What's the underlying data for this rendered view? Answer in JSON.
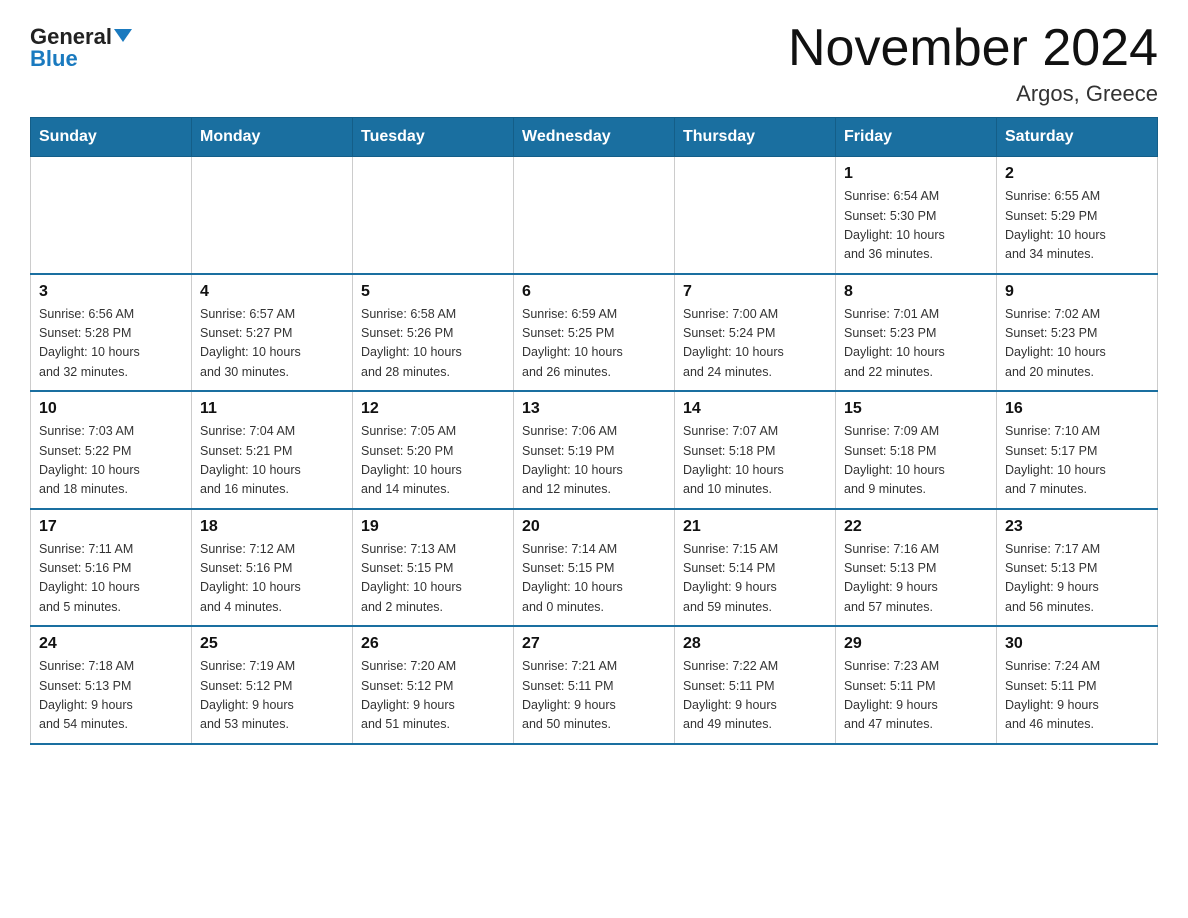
{
  "header": {
    "logo_general": "General",
    "logo_blue": "Blue",
    "title": "November 2024",
    "subtitle": "Argos, Greece"
  },
  "days_of_week": [
    "Sunday",
    "Monday",
    "Tuesday",
    "Wednesday",
    "Thursday",
    "Friday",
    "Saturday"
  ],
  "weeks": [
    [
      {
        "num": "",
        "info": ""
      },
      {
        "num": "",
        "info": ""
      },
      {
        "num": "",
        "info": ""
      },
      {
        "num": "",
        "info": ""
      },
      {
        "num": "",
        "info": ""
      },
      {
        "num": "1",
        "info": "Sunrise: 6:54 AM\nSunset: 5:30 PM\nDaylight: 10 hours\nand 36 minutes."
      },
      {
        "num": "2",
        "info": "Sunrise: 6:55 AM\nSunset: 5:29 PM\nDaylight: 10 hours\nand 34 minutes."
      }
    ],
    [
      {
        "num": "3",
        "info": "Sunrise: 6:56 AM\nSunset: 5:28 PM\nDaylight: 10 hours\nand 32 minutes."
      },
      {
        "num": "4",
        "info": "Sunrise: 6:57 AM\nSunset: 5:27 PM\nDaylight: 10 hours\nand 30 minutes."
      },
      {
        "num": "5",
        "info": "Sunrise: 6:58 AM\nSunset: 5:26 PM\nDaylight: 10 hours\nand 28 minutes."
      },
      {
        "num": "6",
        "info": "Sunrise: 6:59 AM\nSunset: 5:25 PM\nDaylight: 10 hours\nand 26 minutes."
      },
      {
        "num": "7",
        "info": "Sunrise: 7:00 AM\nSunset: 5:24 PM\nDaylight: 10 hours\nand 24 minutes."
      },
      {
        "num": "8",
        "info": "Sunrise: 7:01 AM\nSunset: 5:23 PM\nDaylight: 10 hours\nand 22 minutes."
      },
      {
        "num": "9",
        "info": "Sunrise: 7:02 AM\nSunset: 5:23 PM\nDaylight: 10 hours\nand 20 minutes."
      }
    ],
    [
      {
        "num": "10",
        "info": "Sunrise: 7:03 AM\nSunset: 5:22 PM\nDaylight: 10 hours\nand 18 minutes."
      },
      {
        "num": "11",
        "info": "Sunrise: 7:04 AM\nSunset: 5:21 PM\nDaylight: 10 hours\nand 16 minutes."
      },
      {
        "num": "12",
        "info": "Sunrise: 7:05 AM\nSunset: 5:20 PM\nDaylight: 10 hours\nand 14 minutes."
      },
      {
        "num": "13",
        "info": "Sunrise: 7:06 AM\nSunset: 5:19 PM\nDaylight: 10 hours\nand 12 minutes."
      },
      {
        "num": "14",
        "info": "Sunrise: 7:07 AM\nSunset: 5:18 PM\nDaylight: 10 hours\nand 10 minutes."
      },
      {
        "num": "15",
        "info": "Sunrise: 7:09 AM\nSunset: 5:18 PM\nDaylight: 10 hours\nand 9 minutes."
      },
      {
        "num": "16",
        "info": "Sunrise: 7:10 AM\nSunset: 5:17 PM\nDaylight: 10 hours\nand 7 minutes."
      }
    ],
    [
      {
        "num": "17",
        "info": "Sunrise: 7:11 AM\nSunset: 5:16 PM\nDaylight: 10 hours\nand 5 minutes."
      },
      {
        "num": "18",
        "info": "Sunrise: 7:12 AM\nSunset: 5:16 PM\nDaylight: 10 hours\nand 4 minutes."
      },
      {
        "num": "19",
        "info": "Sunrise: 7:13 AM\nSunset: 5:15 PM\nDaylight: 10 hours\nand 2 minutes."
      },
      {
        "num": "20",
        "info": "Sunrise: 7:14 AM\nSunset: 5:15 PM\nDaylight: 10 hours\nand 0 minutes."
      },
      {
        "num": "21",
        "info": "Sunrise: 7:15 AM\nSunset: 5:14 PM\nDaylight: 9 hours\nand 59 minutes."
      },
      {
        "num": "22",
        "info": "Sunrise: 7:16 AM\nSunset: 5:13 PM\nDaylight: 9 hours\nand 57 minutes."
      },
      {
        "num": "23",
        "info": "Sunrise: 7:17 AM\nSunset: 5:13 PM\nDaylight: 9 hours\nand 56 minutes."
      }
    ],
    [
      {
        "num": "24",
        "info": "Sunrise: 7:18 AM\nSunset: 5:13 PM\nDaylight: 9 hours\nand 54 minutes."
      },
      {
        "num": "25",
        "info": "Sunrise: 7:19 AM\nSunset: 5:12 PM\nDaylight: 9 hours\nand 53 minutes."
      },
      {
        "num": "26",
        "info": "Sunrise: 7:20 AM\nSunset: 5:12 PM\nDaylight: 9 hours\nand 51 minutes."
      },
      {
        "num": "27",
        "info": "Sunrise: 7:21 AM\nSunset: 5:11 PM\nDaylight: 9 hours\nand 50 minutes."
      },
      {
        "num": "28",
        "info": "Sunrise: 7:22 AM\nSunset: 5:11 PM\nDaylight: 9 hours\nand 49 minutes."
      },
      {
        "num": "29",
        "info": "Sunrise: 7:23 AM\nSunset: 5:11 PM\nDaylight: 9 hours\nand 47 minutes."
      },
      {
        "num": "30",
        "info": "Sunrise: 7:24 AM\nSunset: 5:11 PM\nDaylight: 9 hours\nand 46 minutes."
      }
    ]
  ]
}
